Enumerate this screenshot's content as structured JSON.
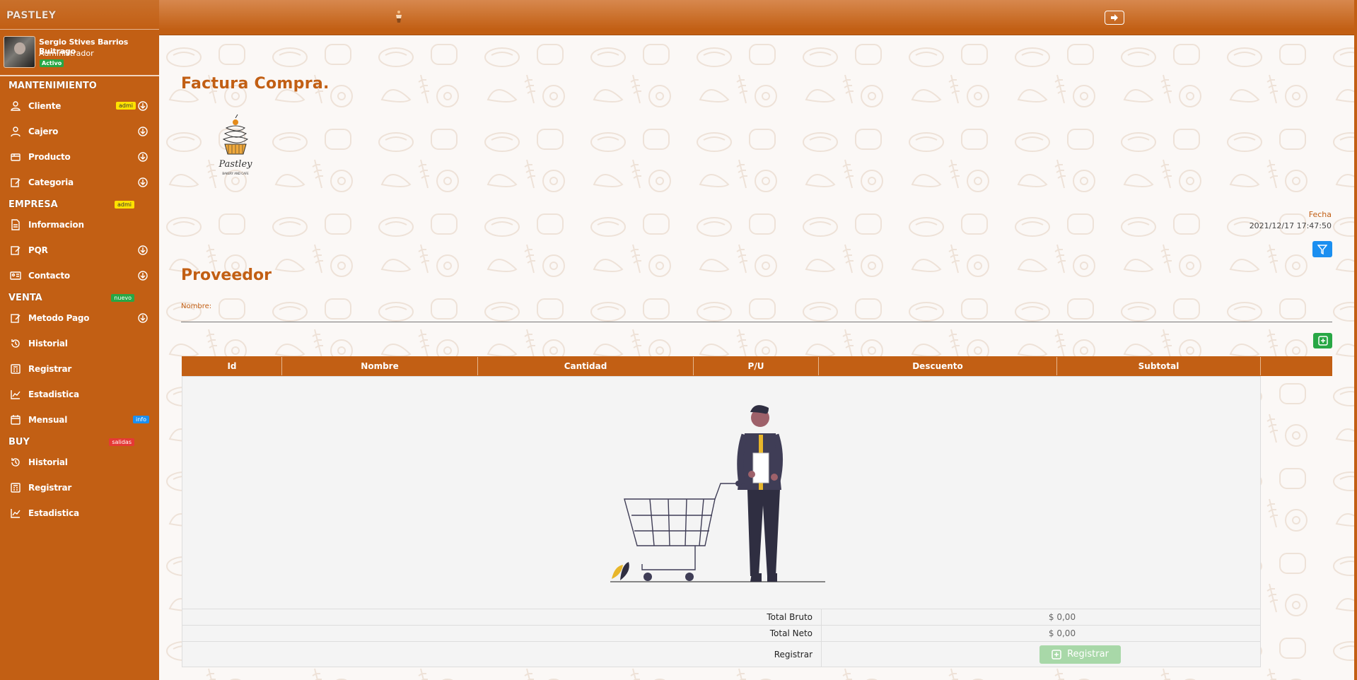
{
  "sidebar": {
    "brand": "PASTLEY",
    "user": {
      "name": "Sergio Stives Barrios Buitrago",
      "role": "Administrador",
      "status": "Activo"
    },
    "sections": [
      {
        "title": "MANTENIMIENTO",
        "badge": ""
      },
      {
        "title": "EMPRESA",
        "badge": "admi"
      },
      {
        "title": "VENTA",
        "badge": "nuevo"
      },
      {
        "title": "BUY",
        "badge": "salidas"
      }
    ],
    "items": [
      {
        "label": "Cliente",
        "badge": "admi",
        "icon": "user-outline-icon"
      },
      {
        "label": "Cajero",
        "icon": "person-icon"
      },
      {
        "label": "Producto",
        "icon": "box-icon"
      },
      {
        "label": "Categoria",
        "icon": "edit-icon"
      },
      {
        "label": "Informacion",
        "icon": "document-icon"
      },
      {
        "label": "PQR",
        "icon": "edit-icon"
      },
      {
        "label": "Contacto",
        "icon": "id-card-icon"
      },
      {
        "label": "Metodo Pago",
        "icon": "edit-icon"
      },
      {
        "label": "Historial",
        "icon": "history-icon"
      },
      {
        "label": "Registrar",
        "icon": "calculator-icon"
      },
      {
        "label": "Estadistica",
        "icon": "chart-icon"
      },
      {
        "label": "Mensual",
        "badge": "info",
        "icon": "calendar-icon"
      },
      {
        "label": "Historial",
        "icon": "history-icon"
      },
      {
        "label": "Registrar",
        "icon": "calculator-icon"
      },
      {
        "label": "Estadistica",
        "icon": "chart-icon"
      }
    ]
  },
  "main": {
    "title": "Factura Compra.",
    "logo_text": "Pastley",
    "logo_subtext": "BAKERY AND CAFE",
    "fecha_label": "Fecha",
    "fecha_value": "2021/12/17 17:47:50",
    "proveedor_title": "Proveedor",
    "nombre_label": "Nombre:",
    "table": {
      "columns": [
        "Id",
        "Nombre",
        "Cantidad",
        "P/U",
        "Descuento",
        "Subtotal"
      ]
    },
    "totals": {
      "bruto_label": "Total Bruto",
      "bruto_value": "$ 0,00",
      "neto_label": "Total Neto",
      "neto_value": "$ 0,00",
      "registrar_label": "Registrar",
      "registrar_button": "Registrar"
    }
  },
  "colors": {
    "primary": "#c25f14",
    "blue": "#1b8ff0",
    "green": "#28a745"
  }
}
